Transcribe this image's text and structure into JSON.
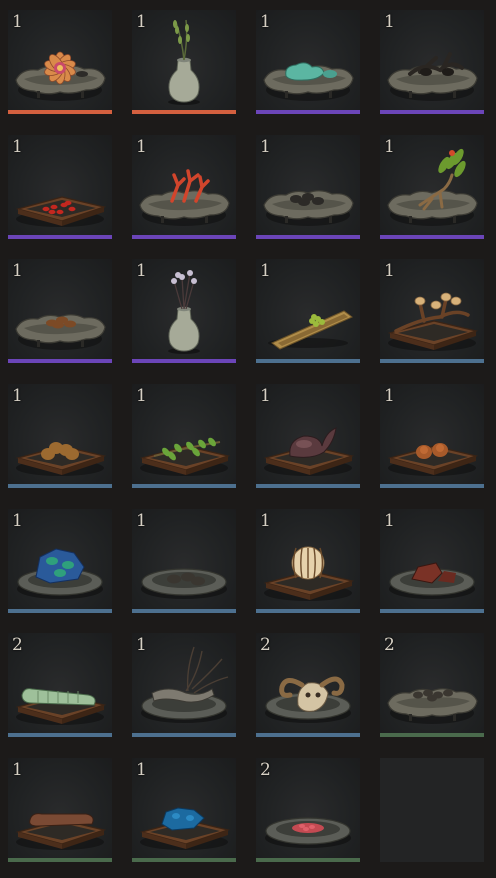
{
  "inventory": {
    "rarity_colors": {
      "legendary": "#d4603f",
      "epic": "#6b45b8",
      "rare": "#4d708f",
      "uncommon": "#4a6a4c"
    },
    "slots": [
      {
        "count": "1",
        "rarity": "legendary",
        "icon": "lotus-flower-on-tray-icon"
      },
      {
        "count": "1",
        "rarity": "legendary",
        "icon": "celadon-vase-with-willow-icon"
      },
      {
        "count": "1",
        "rarity": "epic",
        "icon": "turquoise-stone-on-tray-icon"
      },
      {
        "count": "1",
        "rarity": "epic",
        "icon": "dark-roots-on-tray-icon"
      },
      {
        "count": "1",
        "rarity": "epic",
        "icon": "red-berries-wooden-tray-icon"
      },
      {
        "count": "1",
        "rarity": "epic",
        "icon": "red-coral-on-tray-icon"
      },
      {
        "count": "1",
        "rarity": "epic",
        "icon": "dark-pellets-on-tray-icon"
      },
      {
        "count": "1",
        "rarity": "epic",
        "icon": "ginseng-with-leaves-icon"
      },
      {
        "count": "1",
        "rarity": "epic",
        "icon": "dried-shells-on-tray-icon"
      },
      {
        "count": "1",
        "rarity": "epic",
        "icon": "celadon-vase-dried-flowers-icon"
      },
      {
        "count": "1",
        "rarity": "rare",
        "icon": "bamboo-scoop-green-seeds-icon"
      },
      {
        "count": "1",
        "rarity": "rare",
        "icon": "mushroom-branch-wooden-tray-icon"
      },
      {
        "count": "1",
        "rarity": "rare",
        "icon": "dried-fruit-wooden-tray-icon"
      },
      {
        "count": "1",
        "rarity": "rare",
        "icon": "green-herb-sprig-tray-icon"
      },
      {
        "count": "1",
        "rarity": "rare",
        "icon": "dark-bulb-wooden-tray-icon"
      },
      {
        "count": "1",
        "rarity": "rare",
        "icon": "walnuts-wooden-tray-icon"
      },
      {
        "count": "1",
        "rarity": "rare",
        "icon": "azurite-mineral-dish-icon"
      },
      {
        "count": "1",
        "rarity": "rare",
        "icon": "dark-stones-dish-icon"
      },
      {
        "count": "1",
        "rarity": "rare",
        "icon": "striped-gourd-wooden-tray-icon"
      },
      {
        "count": "1",
        "rarity": "rare",
        "icon": "red-mineral-dish-icon"
      },
      {
        "count": "2",
        "rarity": "rare",
        "icon": "green-root-wooden-tray-icon"
      },
      {
        "count": "1",
        "rarity": "rare",
        "icon": "gnarled-root-dish-icon"
      },
      {
        "count": "2",
        "rarity": "rare",
        "icon": "ram-skull-dish-icon"
      },
      {
        "count": "2",
        "rarity": "uncommon",
        "icon": "dark-chunks-on-tray-icon"
      },
      {
        "count": "1",
        "rarity": "uncommon",
        "icon": "brown-root-wooden-tray-icon"
      },
      {
        "count": "1",
        "rarity": "uncommon",
        "icon": "blue-crystal-wooden-tray-icon"
      },
      {
        "count": "2",
        "rarity": "uncommon",
        "icon": "red-powder-dish-icon"
      },
      {
        "count": "",
        "rarity": "",
        "icon": ""
      }
    ]
  }
}
